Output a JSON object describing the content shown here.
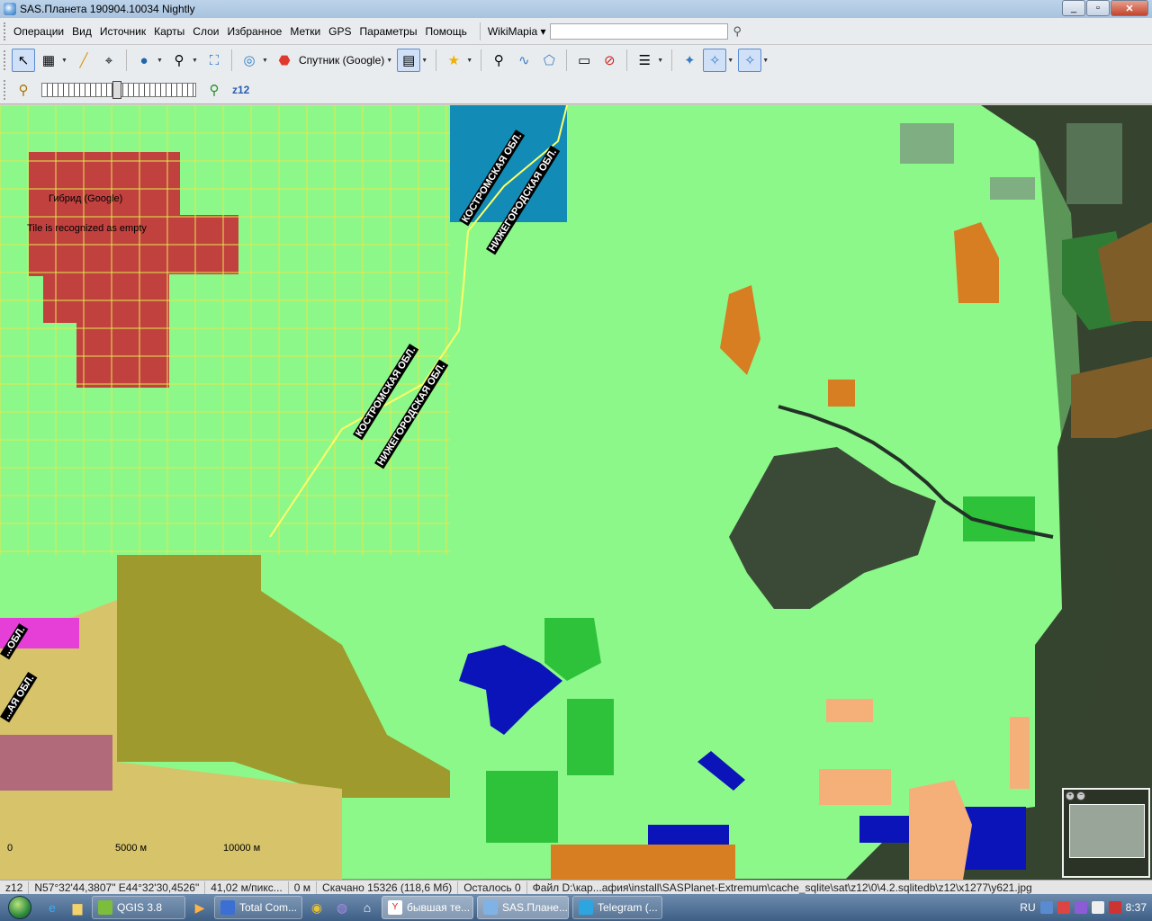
{
  "window": {
    "title": "SAS.Планета 190904.10034 Nightly",
    "minimize": "_",
    "maximize": "▫",
    "close": "✕"
  },
  "menu": [
    "Операции",
    "Вид",
    "Источник",
    "Карты",
    "Слои",
    "Избранное",
    "Метки",
    "GPS",
    "Параметры",
    "Помощь"
  ],
  "search": {
    "provider": "WikiMapia",
    "value": "",
    "go_icon": "search-icon"
  },
  "toolbar": {
    "map_type": "Спутник (Google)",
    "icons": [
      "select-arrow-icon",
      "layers-icon",
      "ruler-icon",
      "compass-icon",
      "globe-icon",
      "magnifier-icon",
      "fullscreen-icon",
      "gps-icon",
      "google-maps-icon",
      "map-type-icon",
      "favorite-star-icon",
      "placemark-icon",
      "path-icon",
      "polygon-icon",
      "note-icon",
      "delete-icon",
      "cache-icon",
      "bird-icon",
      "wikimapia-layer-icon",
      "satellite-layer-icon"
    ]
  },
  "zoom": {
    "label": "z12",
    "level": 12
  },
  "map": {
    "overlay_hybrid": "Гибрид (Google)",
    "overlay_empty": "Tile is recognized as empty",
    "regions": [
      "КОСТРОМСКАЯ ОБЛ.",
      "НИЖЕГОРОДСКАЯ ОБЛ.",
      "КОСТРОМСКАЯ ОБЛ.",
      "НИЖЕГОРОДСКАЯ ОБЛ.",
      "...АЯ ОБЛ.",
      "...ОБЛ."
    ],
    "scale_a": "5000 м",
    "scale_b": "10000 м",
    "scale_zero": "0",
    "colors": {
      "light_green": "#8cf88a",
      "green": "#2ec23a",
      "dark_red": "#c1413f",
      "teal": "#128bb6",
      "orange": "#d77d22",
      "peach": "#f5b07a",
      "olive": "#9e9a2e",
      "tan": "#d6c36a",
      "magenta": "#e53fd7",
      "blue": "#0a14b8",
      "grid_yellow": "#e4e94c"
    }
  },
  "status": {
    "zoom": "z12",
    "coords": "N57°32'44,3807\" E44°32'30,4526\"",
    "resolution": "41,02 м/пикс...",
    "distance": "0 м",
    "downloaded": "Скачано 15326 (118,6 Мб)",
    "remaining": "Осталось 0",
    "file": "Файл D:\\кар...афия\\install\\SASPlanet-Extremum\\cache_sqlite\\sat\\z12\\0\\4.2.sqlitedb\\z12\\x1277\\y621.jpg"
  },
  "taskbar": {
    "tasks": [
      "QGIS 3.8",
      "Total Com...",
      "бывшая те...",
      "SAS.Плане...",
      "Telegram (..."
    ],
    "lang": "RU",
    "time": "8:37"
  }
}
